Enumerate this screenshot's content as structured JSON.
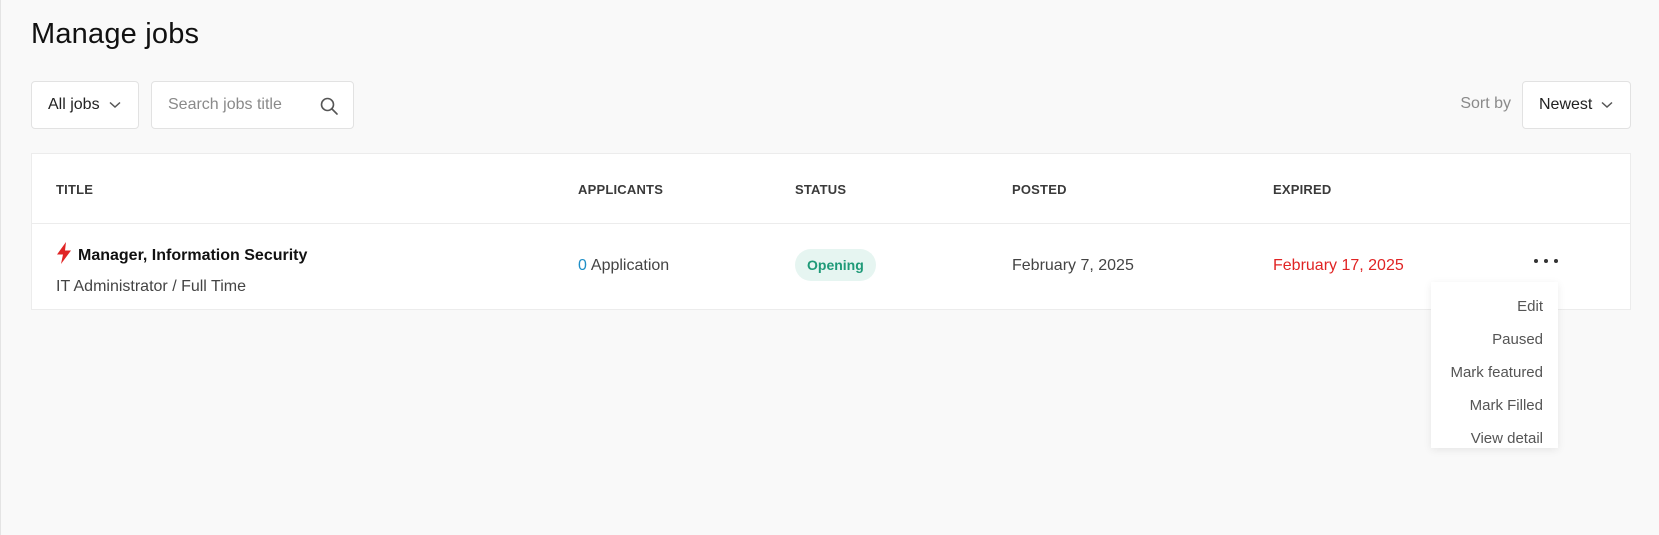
{
  "page": {
    "title": "Manage jobs"
  },
  "toolbar": {
    "filter": {
      "label": "All jobs"
    },
    "search": {
      "placeholder": "Search jobs title",
      "value": ""
    },
    "sort": {
      "label": "Sort by",
      "value": "Newest"
    }
  },
  "table": {
    "columns": [
      "TITLE",
      "APPLICANTS",
      "STATUS",
      "POSTED",
      "EXPIRED"
    ],
    "rows": [
      {
        "title": "Manager, Information Security",
        "subtitle": "IT Administrator / Full Time",
        "applicants_count": "0",
        "applicants_label": "Application",
        "status": "Opening",
        "posted": "February 7, 2025",
        "expired": "February 17, 2025",
        "featured_icon": "lightning-bolt-icon"
      }
    ]
  },
  "action_menu": {
    "items": [
      "Edit",
      "Paused",
      "Mark featured",
      "Mark Filled",
      "View detail"
    ]
  },
  "colors": {
    "accent_blue": "#1f8fc7",
    "status_green": "#1f9a78",
    "status_bg": "#e6f5f1",
    "expired_red": "#e02424",
    "featured_red": "#e02424"
  }
}
